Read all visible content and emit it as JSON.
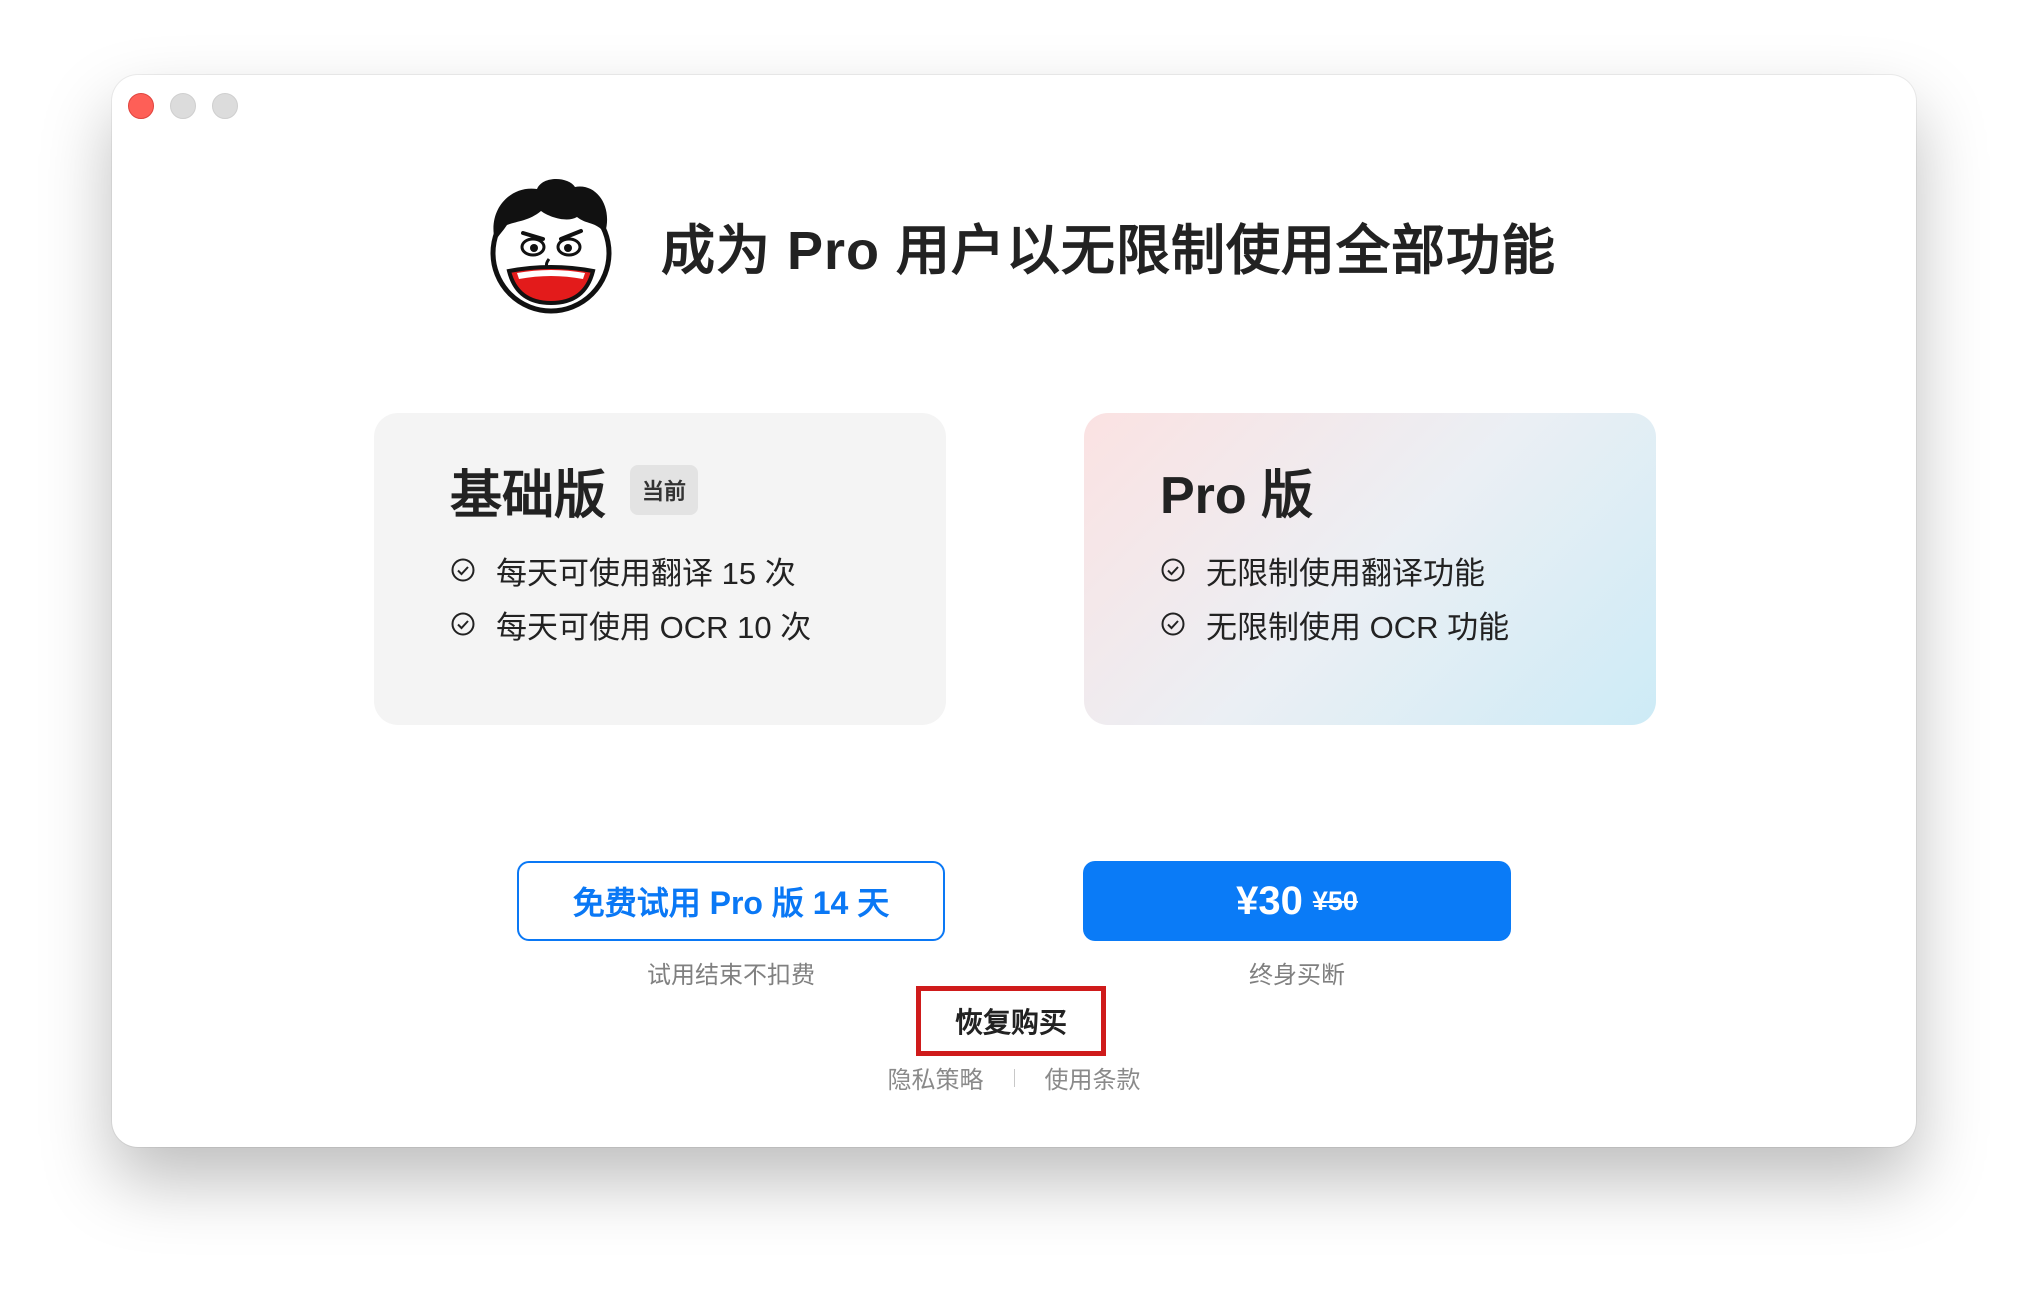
{
  "window": {
    "controls": [
      "close",
      "minimize",
      "zoom"
    ],
    "title": "成为 Pro 用户以无限制使用全部功能",
    "mascot_icon": "cartoon-face-icon"
  },
  "plans": {
    "basic": {
      "title": "基础版",
      "badge": "当前",
      "features": [
        "每天可使用翻译 15 次",
        "每天可使用 OCR 10 次"
      ]
    },
    "pro": {
      "title": "Pro 版",
      "features": [
        "无限制使用翻译功能",
        "无限制使用 OCR 功能"
      ]
    }
  },
  "actions": {
    "trial_label": "免费试用 Pro 版 14 天",
    "trial_note": "试用结束不扣费",
    "price": "¥30",
    "original_price": "¥50",
    "buy_note": "终身买断",
    "restore_label": "恢复购买",
    "privacy_label": "隐私策略",
    "terms_label": "使用条款"
  },
  "colors": {
    "accent": "#0a7bf7",
    "highlight_box": "#cf1b1b",
    "close": "#fe5f57"
  }
}
